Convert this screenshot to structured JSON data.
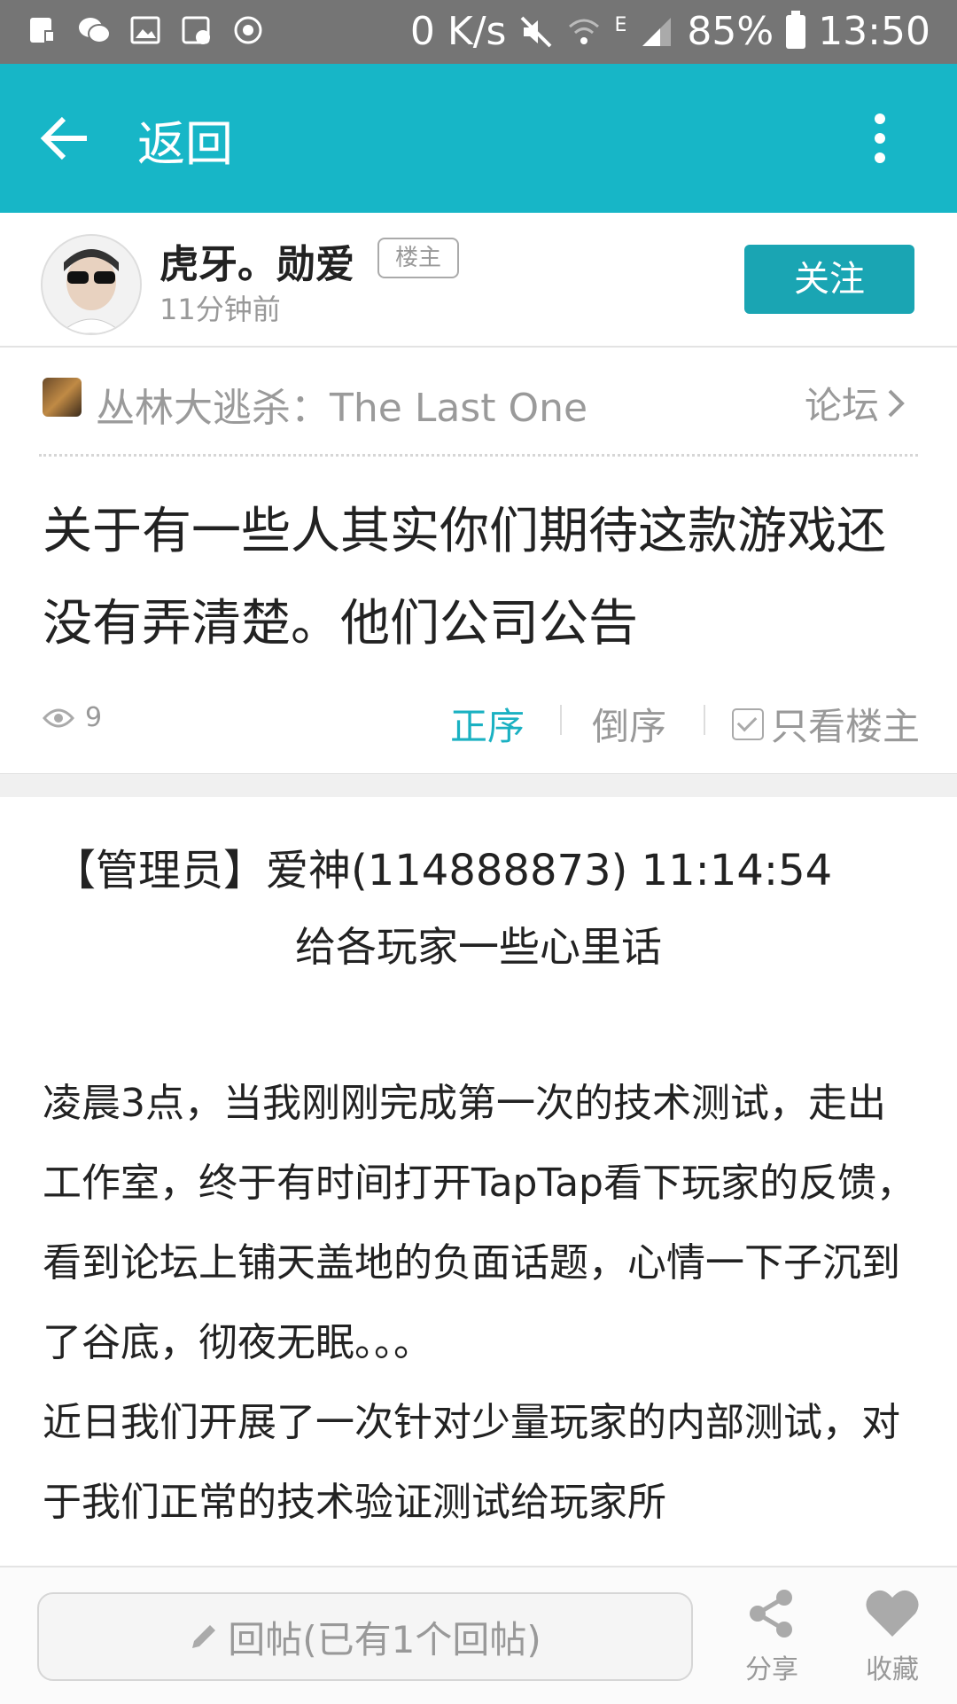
{
  "status_bar": {
    "speed": "0 K/s",
    "network": "E",
    "battery": "85%",
    "time": "13:50"
  },
  "app_bar": {
    "back_label": "返回"
  },
  "author": {
    "name": "虎牙。勋爱",
    "badge": "楼主",
    "time": "11分钟前",
    "follow_label": "关注"
  },
  "forum": {
    "game_title": "丛林大逃杀：The Last One",
    "link_label": "论坛"
  },
  "post": {
    "title": "关于有一些人其实你们期待这款游戏还没有弄清楚。他们公司公告"
  },
  "meta": {
    "views": "9",
    "sort_asc": "正序",
    "sort_desc": "倒序",
    "owner_only": "只看楼主"
  },
  "body": {
    "admin_line": "【管理员】爱神(114888873)  11:14:54",
    "subtitle": "给各玩家一些心里话",
    "paragraph1": "凌晨3点，当我刚刚完成第一次的技术测试，走出工作室，终于有时间打开TapTap看下玩家的反馈，看到论坛上铺天盖地的负面话题，心情一下子沉到了谷底，彻夜无眠。。。",
    "paragraph2": "近日我们开展了一次针对少量玩家的内部测试，对于我们正常的技术验证测试给玩家所"
  },
  "bottom_bar": {
    "reply_label": "回帖(已有1个回帖)",
    "share_label": "分享",
    "fav_label": "收藏"
  },
  "colors": {
    "accent": "#17b6c7",
    "follow": "#1aa5b3",
    "status_bar": "#757575"
  },
  "icons": [
    "back-arrow-icon",
    "more-icon",
    "eye-icon",
    "chevron-right-icon",
    "pencil-icon",
    "share-icon",
    "heart-icon"
  ]
}
